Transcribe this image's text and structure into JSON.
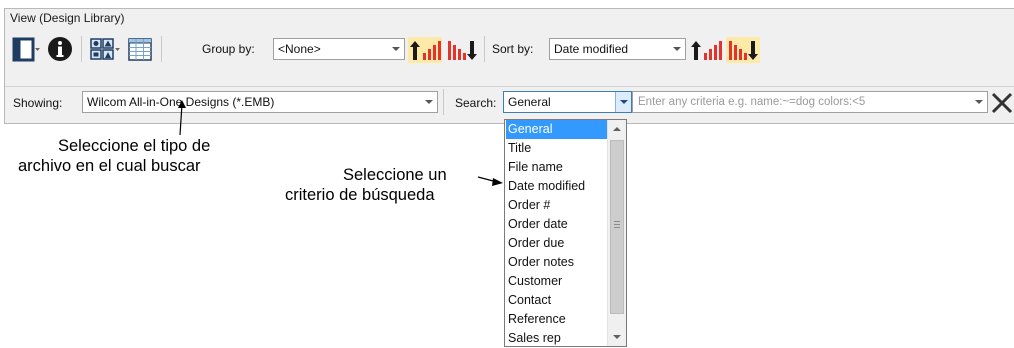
{
  "panel": {
    "title": "View (Design Library)"
  },
  "toolbar": {
    "group_by_label": "Group by:",
    "group_by_value": "<None>",
    "sort_by_label": "Sort by:",
    "sort_by_value": "Date modified"
  },
  "filter": {
    "showing_label": "Showing:",
    "showing_value": "Wilcom All-in-One Designs (*.EMB)",
    "search_label": "Search:",
    "search_value": "General",
    "criteria_placeholder": "Enter any criteria e.g. name:~=dog colors:<5"
  },
  "dropdown": {
    "items": [
      "General",
      "Title",
      "File name",
      "Date modified",
      "Order #",
      "Order date",
      "Order due",
      "Order notes",
      "Customer",
      "Contact",
      "Reference",
      "Sales rep"
    ],
    "selected": "General"
  },
  "annotations": {
    "file_type_line1": "Seleccione el tipo de",
    "file_type_line2": "archivo en el cual buscar",
    "criterion_line1": "Seleccione un",
    "criterion_line2": "criterio de búsqueda"
  },
  "colors": {
    "selection": "#3399ff",
    "highlight": "#fde9a8",
    "ascending_arrow": "#e5322a",
    "accent_dark": "#1f3d63"
  },
  "icons": [
    "layout-icon",
    "info-icon",
    "thumbnails-icon",
    "grid-view-icon",
    "sort-ascending-icon",
    "sort-descending-icon",
    "close-icon"
  ]
}
